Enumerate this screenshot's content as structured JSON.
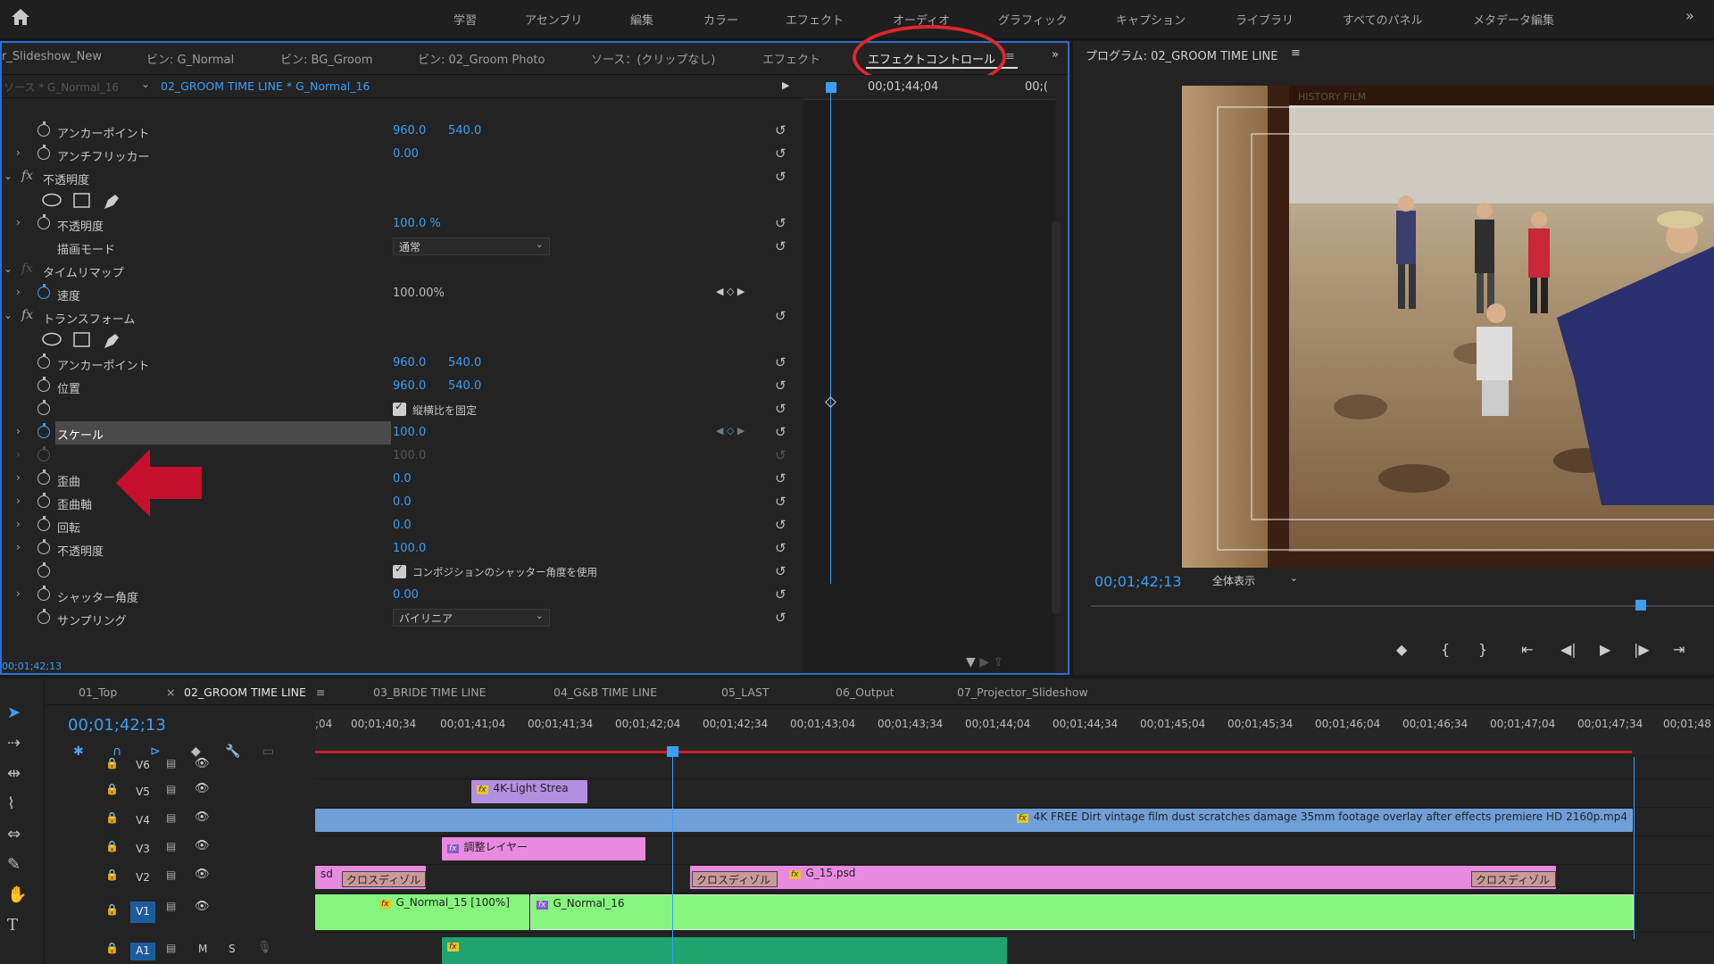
{
  "workspace_tabs": [
    "学習",
    "アセンブリ",
    "編集",
    "カラー",
    "エフェクト",
    "オーディオ",
    "グラフィック",
    "キャプション",
    "ライブラリ",
    "すべてのパネル",
    "メタデータ編集"
  ],
  "panel_tabs": [
    "r_Slideshow_New",
    "ビン: G_Normal",
    "ビン: BG_Groom",
    "ビン: 02_Groom Photo",
    "ソース：(クリップなし)",
    "エフェクト",
    "エフェクトコントロール"
  ],
  "source_row": {
    "source": "ソース * G_Normal_16",
    "sequence": "02_GROOM TIME LINE * G_Normal_16"
  },
  "ec_ruler_time": "00;01;44;04",
  "ec_ruler_time2": "00;(",
  "effect_rows": [
    {
      "label": "アンカーポイント",
      "v1": "960.0",
      "v2": "540.0"
    },
    {
      "label": "アンチフリッカー",
      "v1": "0.00"
    },
    {
      "label": "不透明度"
    },
    {
      "label": "不透明度",
      "v1": "100.0 %"
    },
    {
      "label": "描画モード",
      "dropdown": "通常"
    },
    {
      "label": "タイムリマップ"
    },
    {
      "label": "速度",
      "v1": "100.00%"
    },
    {
      "label": "トランスフォーム"
    },
    {
      "label": "アンカーポイント",
      "v1": "960.0",
      "v2": "540.0"
    },
    {
      "label": "位置",
      "v1": "960.0",
      "v2": "540.0"
    },
    {
      "label": "縦横比を固定"
    },
    {
      "label": "スケール",
      "v1": "100.0"
    },
    {
      "label": "",
      "v1": "100.0"
    },
    {
      "label": "歪曲",
      "v1": "0.0"
    },
    {
      "label": "歪曲軸",
      "v1": "0.0"
    },
    {
      "label": "回転",
      "v1": "0.0"
    },
    {
      "label": "不透明度",
      "v1": "100.0"
    },
    {
      "label": "コンポジションのシャッター角度を使用"
    },
    {
      "label": "シャッター角度",
      "v1": "0.00"
    },
    {
      "label": "サンプリング",
      "dropdown": "バイリニア"
    }
  ],
  "ec_current_time": "00;01;42;13",
  "program": {
    "title": "プログラム: 02_GROOM TIME LINE",
    "time": "00;01;42;13",
    "zoom": "全体表示",
    "video_banner": "HISTORY FILM"
  },
  "sequence_tabs": [
    "01_Top",
    "02_GROOM TIME LINE",
    "03_BRIDE TIME LINE",
    "04_G&B TIME LINE",
    "05_LAST",
    "06_Output",
    "07_Projector_Slideshow"
  ],
  "timeline_time": "00;01;42;13",
  "ruler_ticks": [
    ";04",
    "00;01;40;34",
    "00;01;41;04",
    "00;01;41;34",
    "00;01;42;04",
    "00;01;42;34",
    "00;01;43;04",
    "00;01;43;34",
    "00;01;44;04",
    "00;01;44;34",
    "00;01;45;04",
    "00;01;45;34",
    "00;01;46;04",
    "00;01;46;34",
    "00;01;47;04",
    "00;01;47;34",
    "00;01;48"
  ],
  "tracks": [
    "V6",
    "V5",
    "V4",
    "V3",
    "V2",
    "V1",
    "A1"
  ],
  "clips": {
    "v5": "4K-Light Strea",
    "v4": "4K FREE Dirt vintage film dust scratches damage 35mm footage overlay after effects premiere HD 2160p.mp4",
    "v3": "調整レイヤー",
    "v2_left": "sd",
    "v2_cross1": "クロスディゾル",
    "v2_cross2": "クロスディゾル",
    "v2_g15": "G_15.psd",
    "v2_cross3": "クロスディゾル",
    "v1_g15": "G_Normal_15 [100%]",
    "v1_g16": "G_Normal_16"
  },
  "track_buttons": {
    "mute": "M",
    "solo": "S"
  },
  "colors": {
    "accent": "#3b9ff5",
    "red_annotation": "#e0262c",
    "arrow": "#c8102e",
    "v4_clip": "#6f9fd8",
    "v3_clip": "#e88ae0",
    "v1_clip": "#86f57e",
    "a1_clip": "#1fa36f"
  }
}
